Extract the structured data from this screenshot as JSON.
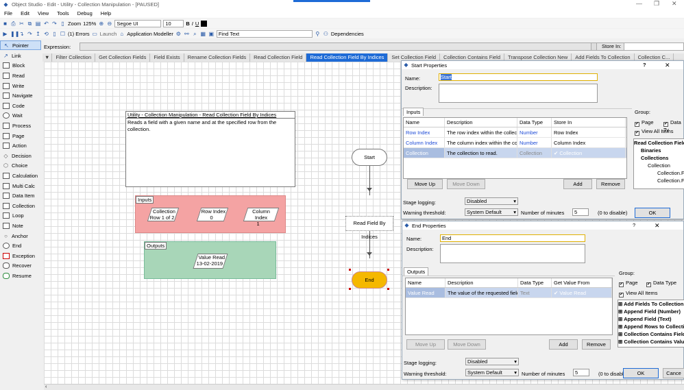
{
  "window": {
    "title": "Object Studio  - Edit - Utility - Collection Manipulation - [PAUSED]"
  },
  "menu": [
    "File",
    "Edit",
    "View",
    "Tools",
    "Debug",
    "Help"
  ],
  "toolbar": {
    "errors": "(1) Errors",
    "launch": "Launch",
    "app_modeller": "Application Modeller",
    "zoom_label": "Zoom",
    "zoom_value": "125%",
    "font_name": "Segoe UI",
    "font_size": "10",
    "find_text": "Find Text",
    "dependencies": "Dependencies",
    "bold": "B",
    "italic": "I",
    "underline": "U"
  },
  "expression": {
    "label": "Expression:",
    "store_in_label": "Store In:"
  },
  "tools": [
    "Pointer",
    "Link",
    "Block",
    "Read",
    "Write",
    "Navigate",
    "Code",
    "Wait",
    "Process",
    "Page",
    "Action",
    "Decision",
    "Choice",
    "Calculation",
    "Multi Calc",
    "Data Item",
    "Collection",
    "Loop",
    "Note",
    "Anchor",
    "End",
    "Exception",
    "Recover",
    "Resume"
  ],
  "page_tabs": [
    "Filter Collection",
    "Get Collection Fields",
    "Field Exists",
    "Rename Collection Fields",
    "Read Collection Field",
    "Read Collection Field By Indices",
    "Set Collection Field",
    "Collection Contains Field",
    "Transpose Collection New",
    "Add Fields To Collection",
    "Collection C..."
  ],
  "diagram": {
    "info_title": "Utility - Collection Manipulation - Read Collection Field By Indices",
    "info_desc": "Reads a field with a given name and at the specified row from the collection.",
    "inputs_label": "Inputs",
    "outputs_label": "Outputs",
    "collection_name": "Collection",
    "collection_row": "Row 1 of 2",
    "row_index_name": "Row Index",
    "row_index_value": "0",
    "col_index_name": "Column Index",
    "col_index_value": "1",
    "value_read_name": "Value Read",
    "value_read_value": "13-02-2019",
    "start": "Start",
    "action": "Read Field By Indices",
    "end": "End"
  },
  "start_props": {
    "title": "Start Properties",
    "name_label": "Name:",
    "name_value": "Start",
    "desc_label": "Description:",
    "inputs_tab": "Inputs",
    "columns": [
      "Name",
      "Description",
      "Data Type",
      "Store In"
    ],
    "rows": [
      [
        "Row Index",
        "The row index within the collectio...",
        "Number",
        "Row Index"
      ],
      [
        "Column Index",
        "The column index within the colle...",
        "Number",
        "Column Index"
      ],
      [
        "Collection",
        "The collection to read.",
        "Collection",
        "Collection"
      ]
    ],
    "move_up": "Move Up",
    "move_down": "Move Down",
    "add": "Add",
    "remove": "Remove",
    "group_label": "Group:",
    "page_chk": "Page",
    "datatype_chk": "Data Ty",
    "view_all": "View All Items",
    "tree": [
      "Read Collection Field By",
      "Binaries",
      "Collections",
      "Collection",
      "Collection.Fi",
      "Collection.Fi"
    ],
    "stage_logging_label": "Stage logging:",
    "stage_logging": "Disabled",
    "warning_label": "Warning threshold:",
    "warning": "System Default",
    "minutes_label": "Number of minutes",
    "minutes": "5",
    "disable_hint": "(0 to disable)",
    "ok": "OK",
    "help": "?"
  },
  "end_props": {
    "title": "End Properties",
    "name_label": "Name:",
    "name_value": "End",
    "desc_label": "Description:",
    "outputs_tab": "Outputs",
    "columns": [
      "Name",
      "Description",
      "Data Type",
      "Get Value From"
    ],
    "rows": [
      [
        "Value Read",
        "The value of the requested field as te",
        "Text",
        "Value Read"
      ]
    ],
    "move_up": "Move Up",
    "move_down": "Move Down",
    "add": "Add",
    "remove": "Remove",
    "group_label": "Group:",
    "page_chk": "Page",
    "datatype_chk": "Data Type",
    "view_all": "View All Items",
    "tree": [
      "Add Fields To Collection",
      "Append Field (Number)",
      "Append Field (Text)",
      "Append Rows to Collection",
      "Collection Contains Field",
      "Collection Contains Value"
    ],
    "stage_logging_label": "Stage logging:",
    "stage_logging": "Disabled",
    "warning_label": "Warning threshold:",
    "warning": "System Default",
    "minutes_label": "Number of minutes",
    "minutes": "5",
    "disable_hint": "(0 to disable)",
    "ok": "OK",
    "cancel": "Cance",
    "help": "?"
  }
}
